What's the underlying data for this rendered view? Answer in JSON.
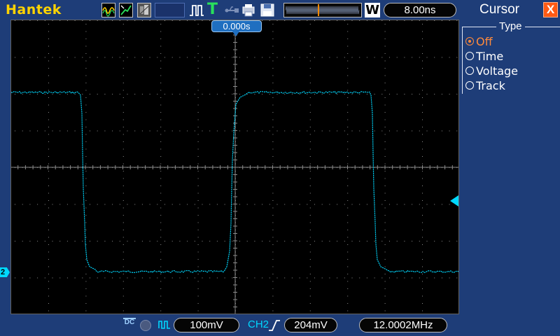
{
  "header": {
    "brand": "Hantek",
    "trigger_glyph": "T",
    "mode_label": "W",
    "timebase": "8.00ns"
  },
  "scope": {
    "trigger_position": "0.000s",
    "channel_marker": "2",
    "trace_color": "#00d8ff",
    "grid_color": "#8c8c8c",
    "background": "#000000",
    "waveform": "square"
  },
  "status": {
    "coupling_top": "DC",
    "volts_per_div": "100mV",
    "trigger_source": "CH2",
    "trigger_level": "204mV",
    "frequency": "12.0002MHz"
  },
  "panel": {
    "title": "Cursor",
    "close_glyph": "X",
    "group_label": "Type",
    "options": [
      {
        "label": "Off",
        "selected": true
      },
      {
        "label": "Time",
        "selected": false
      },
      {
        "label": "Voltage",
        "selected": false
      },
      {
        "label": "Track",
        "selected": false
      }
    ]
  },
  "colors": {
    "chrome": "#1e3d78",
    "accent_orange": "#ff8a3c",
    "brand_yellow": "#ffd400",
    "close_red": "#ff5a14"
  }
}
